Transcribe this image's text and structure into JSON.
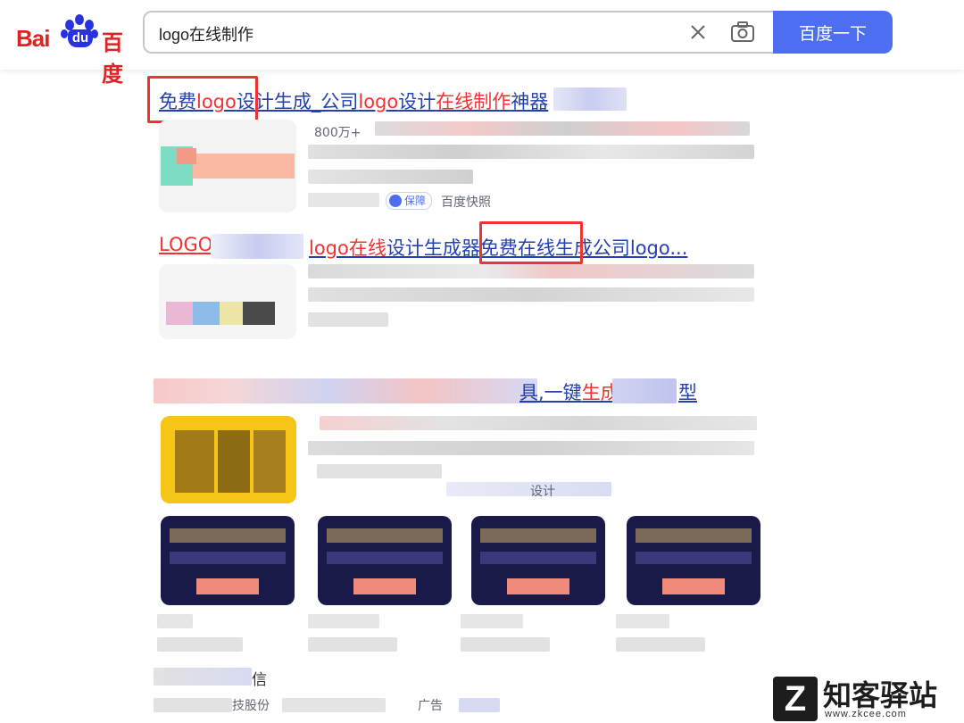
{
  "header": {
    "logo_latin": "Bai",
    "logo_du": "du",
    "logo_cn": "百度",
    "query": "logo在线制作",
    "search_button": "百度一下"
  },
  "results": [
    {
      "title_parts": [
        {
          "t": "免费",
          "hl": false
        },
        {
          "t": "logo",
          "hl": true
        },
        {
          "t": "设计生成_公司",
          "hl": false
        },
        {
          "t": "logo",
          "hl": true
        },
        {
          "t": "设计",
          "hl": false
        },
        {
          "t": "在线制作",
          "hl": true
        },
        {
          "t": "神器",
          "hl": false
        }
      ],
      "meta_prefix": "800万+",
      "guarantee": "保障",
      "snapshot": "百度快照"
    },
    {
      "title_left": "LOGO",
      "title_parts": [
        {
          "t": "logo",
          "hl": true
        },
        {
          "t": "在线",
          "hl": true
        },
        {
          "t": "设计生成器",
          "hl": false
        },
        {
          "t": "免费在线生成公司logo...",
          "hl": false
        }
      ]
    },
    {
      "title_visible": "具,一键",
      "title_hl": "生成",
      "title_tail": "型",
      "subtitle_fragment": "设计"
    }
  ],
  "footer_fragments": {
    "trust": "信",
    "company": "技股份",
    "ad": "广告"
  },
  "watermark": {
    "icon": "Z",
    "text": "知客驿站",
    "url": "www.zkcee.com"
  }
}
